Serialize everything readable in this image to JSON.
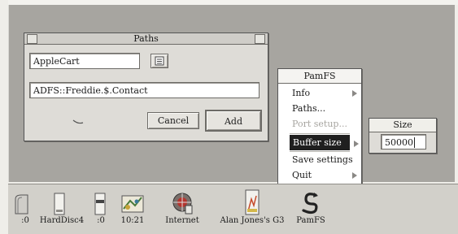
{
  "paths_window": {
    "title": "Paths",
    "name_value": "AppleCart",
    "path_value": "ADFS::Freddie.$.Contact",
    "cancel_label": "Cancel",
    "add_label": "Add"
  },
  "pamfs_menu": {
    "title": "PamFS",
    "items": [
      {
        "label": "Info",
        "has_submenu": true,
        "enabled": true
      },
      {
        "label": "Paths...",
        "has_submenu": false,
        "enabled": true
      },
      {
        "label": "Port setup...",
        "has_submenu": false,
        "enabled": false
      },
      {
        "label": "Buffer size",
        "has_submenu": true,
        "enabled": true,
        "selected": true
      },
      {
        "label": "Save settings",
        "has_submenu": false,
        "enabled": true
      },
      {
        "label": "Quit",
        "has_submenu": true,
        "enabled": true
      }
    ]
  },
  "size_submenu": {
    "title": "Size",
    "value": "50000"
  },
  "iconbar": {
    "items": [
      {
        "label": ":0",
        "icon": "floppy-drive-icon"
      },
      {
        "label": "HardDisc4",
        "icon": "hard-disc-icon"
      },
      {
        "label": ":0",
        "icon": "ram-disc-icon"
      },
      {
        "label": "10:21",
        "icon": "paint-app-icon"
      },
      {
        "label": "Internet",
        "icon": "internet-globe-icon"
      },
      {
        "label": "Alan Jones's G3",
        "icon": "network-computer-icon"
      },
      {
        "label": "PamFS",
        "icon": "pamfs-app-icon"
      }
    ]
  },
  "colors": {
    "desktop": "#a7a5a0",
    "window": "#dedcd7",
    "menu_highlight": "#1f1f1f"
  }
}
